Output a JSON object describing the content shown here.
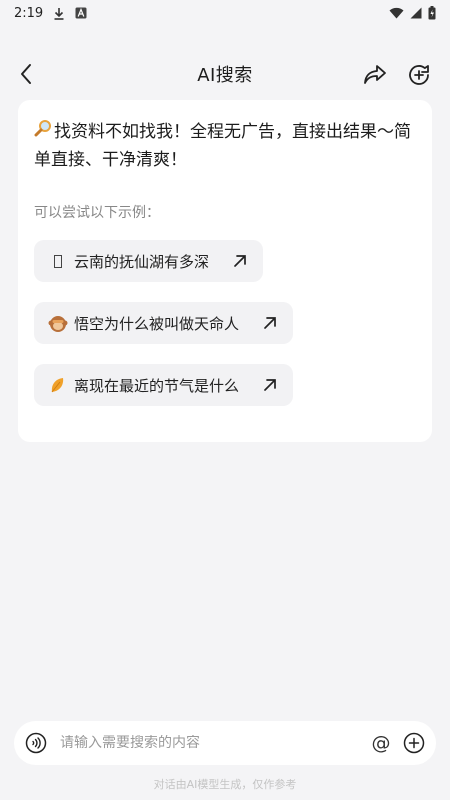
{
  "status_bar": {
    "time": "2:19",
    "icons": [
      "download-icon",
      "app-a-icon",
      "wifi-icon",
      "signal-icon",
      "battery-charging-icon"
    ]
  },
  "header": {
    "title": "AI搜索",
    "back_icon": "chevron-left-icon",
    "share_icon": "share-icon",
    "new_chat_icon": "new-chat-icon"
  },
  "card": {
    "intro_icon": "magnifier-icon",
    "intro_text": "找资料不如找我！全程无广告，直接出结果～简单直接、干净清爽！",
    "hint": "可以尝试以下示例：",
    "examples": [
      {
        "icon": "missing-glyph-icon",
        "text": "云南的抚仙湖有多深"
      },
      {
        "icon": "monkey-icon",
        "text": "悟空为什么被叫做天命人"
      },
      {
        "icon": "leaf-icon",
        "text": "离现在最近的节气是什么"
      }
    ]
  },
  "input_bar": {
    "placeholder": "请输入需要搜索的内容",
    "value": "",
    "voice_icon": "voice-icon",
    "at_label": "@",
    "plus_icon": "plus-icon"
  },
  "disclaimer": "对话由AI模型生成，仅作参考",
  "colors": {
    "background": "#f4f4f6",
    "card": "#ffffff",
    "chip": "#f2f2f4",
    "text": "#1f1f1f",
    "hint": "#888888"
  }
}
